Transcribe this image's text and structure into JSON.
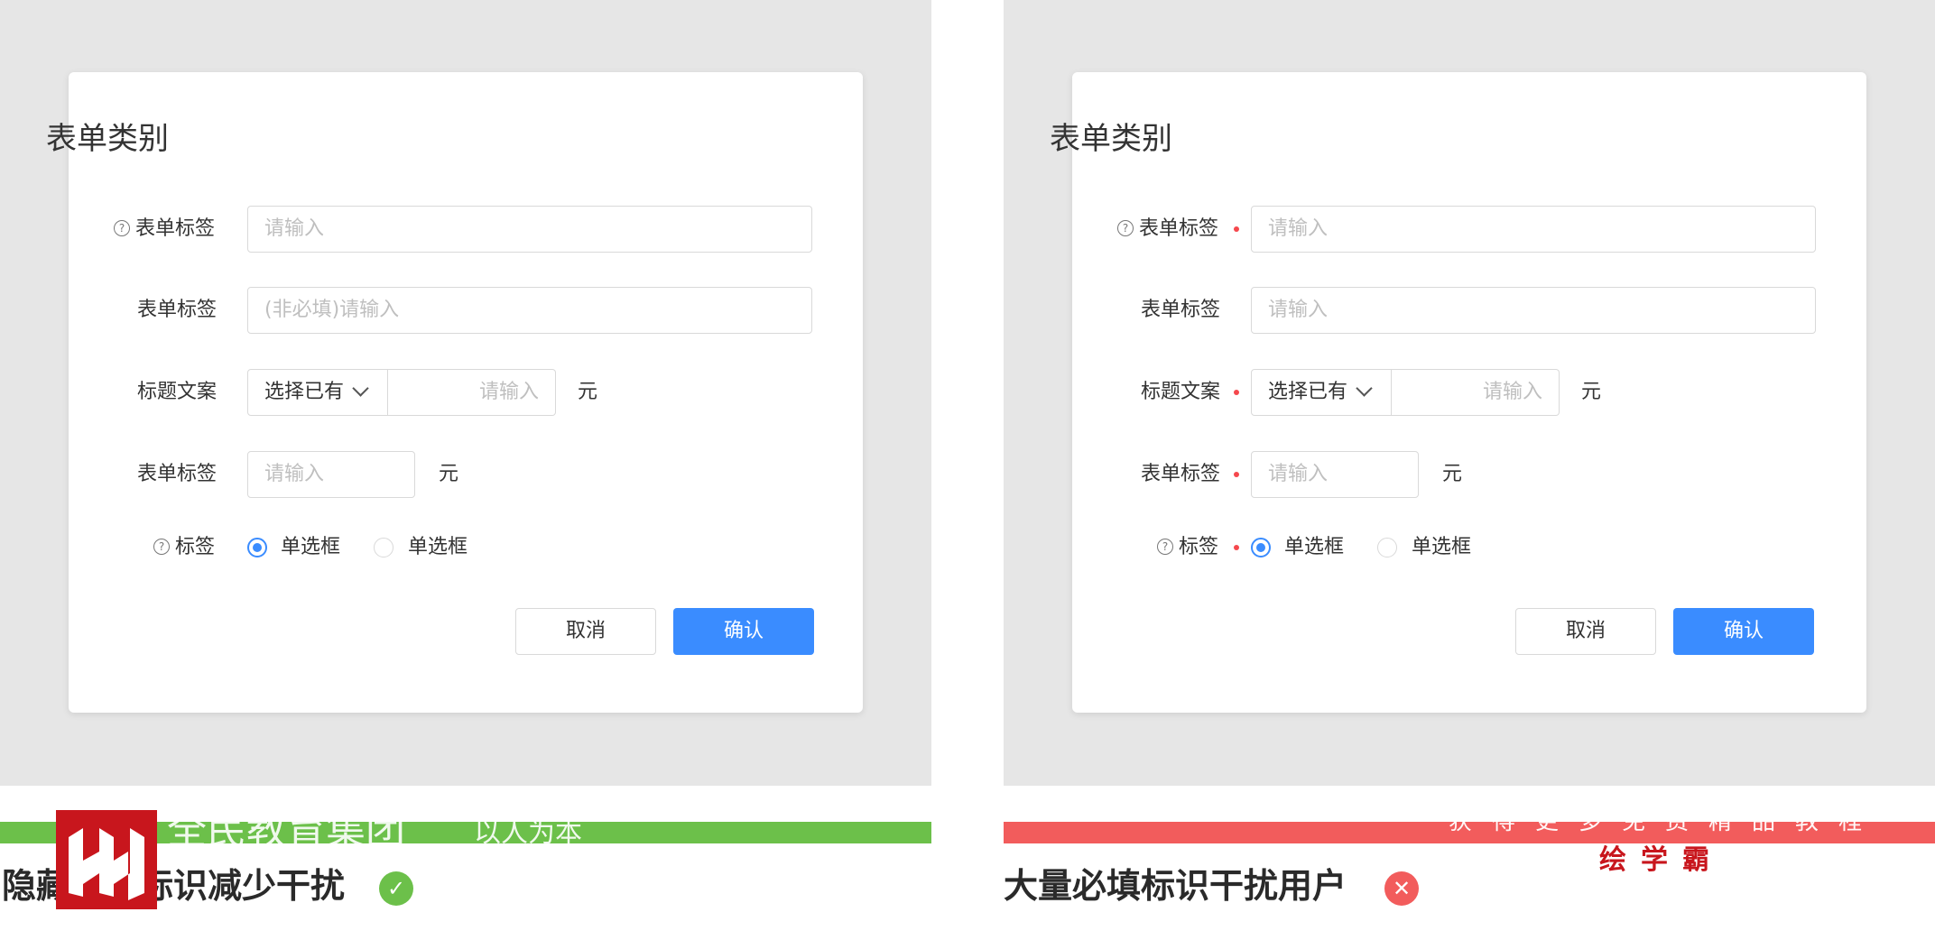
{
  "left_panel": {
    "dialog": {
      "title": "表单类别",
      "rows": [
        {
          "label": "表单标签",
          "placeholder": "请输入"
        },
        {
          "label": "表单标签",
          "placeholder": "(非必填)请输入"
        },
        {
          "label": "标题文案",
          "select_value": "选择已有",
          "placeholder": "请输入",
          "unit": "元"
        },
        {
          "label": "表单标签",
          "placeholder": "请输入",
          "unit": "元"
        }
      ],
      "radio_row": {
        "label": "标签",
        "options": [
          "单选框",
          "单选框"
        ],
        "selected_index": 0
      },
      "cancel_label": "取消",
      "confirm_label": "确认"
    },
    "caption": "隐藏必填标识减少干扰",
    "status": "good"
  },
  "right_panel": {
    "dialog": {
      "title": "表单类别",
      "rows": [
        {
          "label": "表单标签",
          "placeholder": "请输入",
          "required": true
        },
        {
          "label": "表单标签",
          "placeholder": "请输入",
          "required": false
        },
        {
          "label": "标题文案",
          "select_value": "选择已有",
          "placeholder": "请输入",
          "unit": "元",
          "required": true
        },
        {
          "label": "表单标签",
          "placeholder": "请输入",
          "unit": "元",
          "required": true
        }
      ],
      "radio_row": {
        "label": "标签",
        "options": [
          "单选框",
          "单选框"
        ],
        "selected_index": 0,
        "required": true
      },
      "cancel_label": "取消",
      "confirm_label": "确认"
    },
    "caption": "大量必填标识干扰用户",
    "status": "bad"
  },
  "watermarks": {
    "left_text": "全民教育集团",
    "left_slogan": "以人为本",
    "right_line1": "获得更多免费精品教程",
    "right_line2": "绘学霸"
  },
  "colors": {
    "primary": "#3a8cff",
    "required": "#f5484d",
    "good": "#6cc04a",
    "bad": "#f25c5c",
    "panel_bg": "#e6e6e6",
    "logo_red": "#c8161d"
  }
}
